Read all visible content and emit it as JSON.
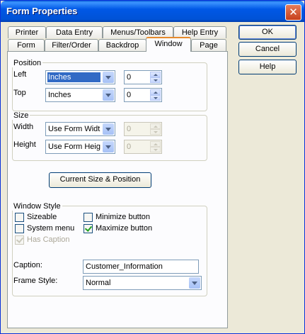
{
  "window": {
    "title": "Form Properties"
  },
  "tabs_row1": [
    "Printer",
    "Data Entry",
    "Menus/Toolbars",
    "Help Entry"
  ],
  "tabs_row2": [
    "Form",
    "Filter/Order",
    "Backdrop",
    "Window",
    "Page"
  ],
  "active_tab": "Window",
  "buttons": {
    "ok": "OK",
    "cancel": "Cancel",
    "help": "Help"
  },
  "position": {
    "group_label": "Position",
    "left_label": "Left",
    "left_unit": "Inches",
    "left_value": "0",
    "top_label": "Top",
    "top_unit": "Inches",
    "top_value": "0"
  },
  "size": {
    "group_label": "Size",
    "width_label": "Width",
    "width_mode": "Use Form Width",
    "width_value": "0",
    "height_label": "Height",
    "height_mode": "Use Form Height",
    "height_value": "0"
  },
  "current_size_button": "Current Size & Position",
  "window_style": {
    "group_label": "Window Style",
    "sizeable": {
      "label": "Sizeable",
      "checked": false
    },
    "system_menu": {
      "label": "System menu",
      "checked": false
    },
    "has_caption": {
      "label": "Has Caption",
      "checked": true,
      "disabled": true
    },
    "minimize": {
      "label": "Minimize button",
      "checked": false
    },
    "maximize": {
      "label": "Maximize button",
      "checked": true
    },
    "caption_label": "Caption:",
    "caption_value": "Customer_Information",
    "frame_style_label": "Frame Style:",
    "frame_style_value": "Normal"
  },
  "icons": {
    "close": "close-icon",
    "dropdown": "chevron-down-icon",
    "spin_up": "spin-up-icon",
    "spin_down": "spin-down-icon",
    "check": "checkmark-icon"
  }
}
